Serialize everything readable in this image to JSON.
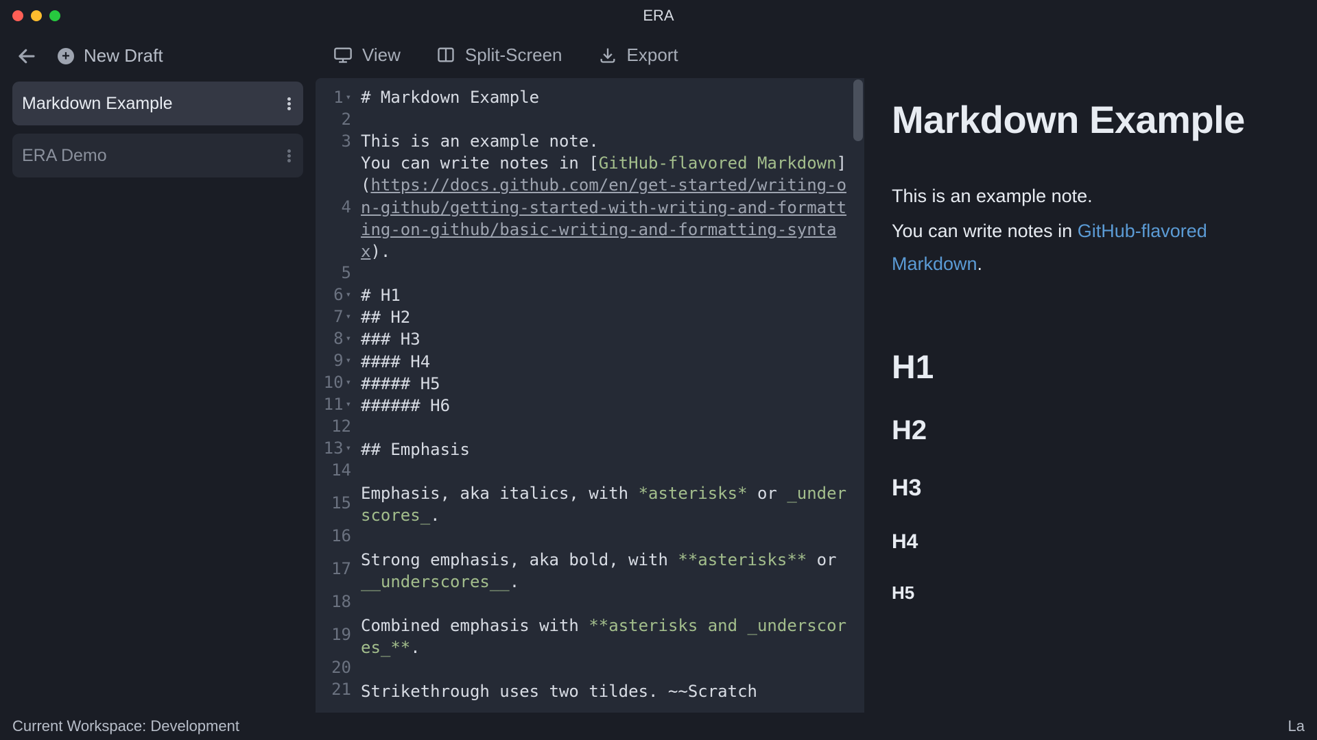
{
  "app": {
    "title": "ERA"
  },
  "sidebar": {
    "new_draft_label": "New Draft",
    "items": [
      {
        "label": "Markdown Example",
        "active": true
      },
      {
        "label": "ERA Demo",
        "active": false
      }
    ]
  },
  "toolbar": {
    "view_label": "View",
    "split_label": "Split-Screen",
    "export_label": "Export"
  },
  "editor": {
    "lines": [
      {
        "n": 1,
        "fold": true,
        "raw": "# Markdown Example"
      },
      {
        "n": 2,
        "fold": false,
        "raw": ""
      },
      {
        "n": 3,
        "fold": false,
        "raw": "This is an example note."
      },
      {
        "n": 4,
        "fold": false,
        "link_pre": "You can write notes in [",
        "link_text": "GitHub-flavored Markdown",
        "link_mid": "](",
        "link_url": "https://docs.github.com/en/get-started/writing-on-github/getting-started-with-writing-and-formatting-on-github/basic-writing-and-formatting-syntax",
        "link_post": ")."
      },
      {
        "n": 5,
        "fold": false,
        "raw": ""
      },
      {
        "n": 6,
        "fold": true,
        "raw": "# H1"
      },
      {
        "n": 7,
        "fold": true,
        "raw": "## H2"
      },
      {
        "n": 8,
        "fold": true,
        "raw": "### H3"
      },
      {
        "n": 9,
        "fold": true,
        "raw": "#### H4"
      },
      {
        "n": 10,
        "fold": true,
        "raw": "##### H5"
      },
      {
        "n": 11,
        "fold": true,
        "raw": "###### H6"
      },
      {
        "n": 12,
        "fold": false,
        "raw": ""
      },
      {
        "n": 13,
        "fold": true,
        "raw": "## Emphasis"
      },
      {
        "n": 14,
        "fold": false,
        "raw": ""
      },
      {
        "n": 15,
        "fold": false,
        "emph_pre": "Emphasis, aka italics, with ",
        "emph1": "*asterisks*",
        "emph_mid": " or ",
        "emph2": "_underscores_",
        "emph_post": "."
      },
      {
        "n": 16,
        "fold": false,
        "raw": ""
      },
      {
        "n": 17,
        "fold": false,
        "emph_pre": "Strong emphasis, aka bold, with ",
        "emph1": "**asterisks**",
        "emph_mid": " or ",
        "emph2": "__underscores__",
        "emph_post": "."
      },
      {
        "n": 18,
        "fold": false,
        "raw": ""
      },
      {
        "n": 19,
        "fold": false,
        "emph_pre": "Combined emphasis with ",
        "emph1": "**asterisks and _underscores_**",
        "emph_mid": "",
        "emph2": "",
        "emph_post": "."
      },
      {
        "n": 20,
        "fold": false,
        "raw": ""
      },
      {
        "n": 21,
        "fold": false,
        "raw": "Strikethrough uses two tildes. ~~Scratch"
      }
    ]
  },
  "preview": {
    "title": "Markdown Example",
    "p1": "This is an example note.",
    "p2_pre": "You can write notes in ",
    "p2_link": "GitHub-flavored Markdown",
    "p2_post": ".",
    "h1": "H1",
    "h2": "H2",
    "h3": "H3",
    "h4": "H4",
    "h5": "H5"
  },
  "status": {
    "workspace": "Current Workspace: Development",
    "right": "La"
  }
}
